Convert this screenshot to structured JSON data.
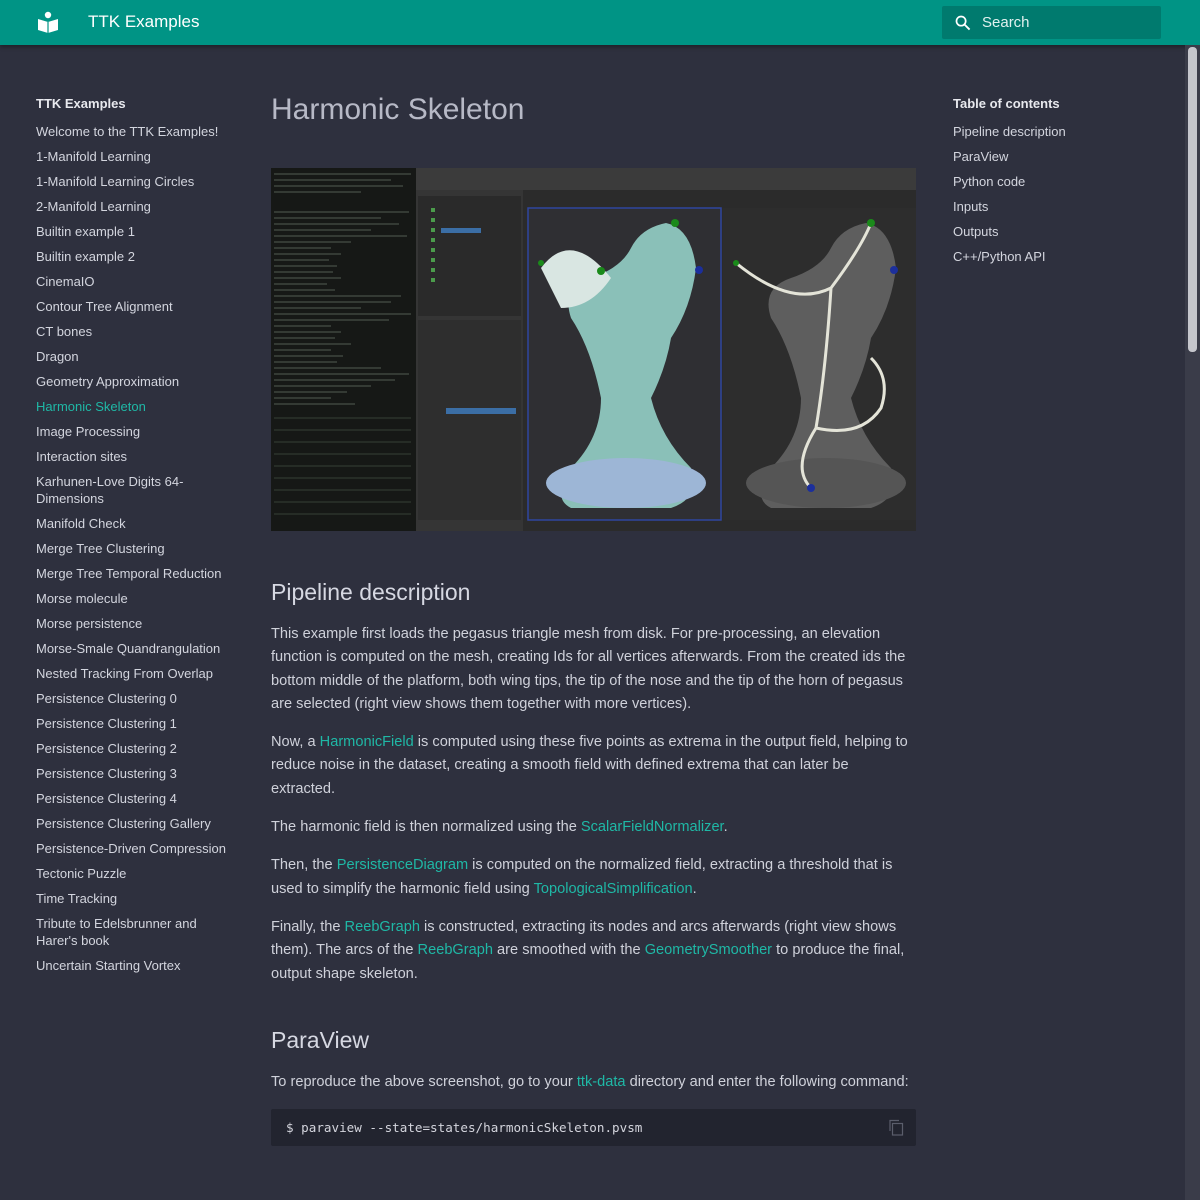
{
  "header": {
    "site_title": "TTK Examples",
    "search_placeholder": "Search"
  },
  "nav": {
    "title": "TTK Examples",
    "items": [
      "Welcome to the TTK Examples!",
      "1-Manifold Learning",
      "1-Manifold Learning Circles",
      "2-Manifold Learning",
      "Builtin example 1",
      "Builtin example 2",
      "CinemaIO",
      "Contour Tree Alignment",
      "CT bones",
      "Dragon",
      "Geometry Approximation",
      "Harmonic Skeleton",
      "Image Processing",
      "Interaction sites",
      "Karhunen-Love Digits 64-Dimensions",
      "Manifold Check",
      "Merge Tree Clustering",
      "Merge Tree Temporal Reduction",
      "Morse molecule",
      "Morse persistence",
      "Morse-Smale Quandrangulation",
      "Nested Tracking From Overlap",
      "Persistence Clustering 0",
      "Persistence Clustering 1",
      "Persistence Clustering 2",
      "Persistence Clustering 3",
      "Persistence Clustering 4",
      "Persistence Clustering Gallery",
      "Persistence-Driven Compression",
      "Tectonic Puzzle",
      "Time Tracking",
      "Tribute to Edelsbrunner and Harer's book",
      "Uncertain Starting Vortex"
    ],
    "active_item": "Harmonic Skeleton"
  },
  "toc": {
    "title": "Table of contents",
    "items": [
      "Pipeline description",
      "ParaView",
      "Python code",
      "Inputs",
      "Outputs",
      "C++/Python API"
    ]
  },
  "content": {
    "page_title": "Harmonic Skeleton",
    "pipeline_heading": "Pipeline description",
    "p1": "This example first loads the pegasus triangle mesh from disk. For pre-processing, an elevation function is computed on the mesh, creating Ids for all vertices afterwards. From the created ids the bottom middle of the platform, both wing tips, the tip of the nose and the tip of the horn of pegasus are selected (right view shows them together with more vertices).",
    "p2": {
      "a": "Now, a ",
      "link1": "HarmonicField",
      "b": " is computed using these five points as extrema in the output field, helping to reduce noise in the dataset, creating a smooth field with defined extrema that can later be extracted."
    },
    "p3": {
      "a": "The harmonic field is then normalized using the ",
      "link1": "ScalarFieldNormalizer",
      "b": "."
    },
    "p4": {
      "a": "Then, the ",
      "link1": "PersistenceDiagram",
      "b": " is computed on the normalized field, extracting a threshold that is used to simplify the harmonic field using ",
      "link2": "TopologicalSimplification",
      "c": "."
    },
    "p5": {
      "a": "Finally, the ",
      "link1": "ReebGraph",
      "b": " is constructed, extracting its nodes and arcs afterwards (right view shows them). The arcs of the ",
      "link2": "ReebGraph",
      "c": " are smoothed with the ",
      "link3": "GeometrySmoother",
      "d": " to produce the final, output shape skeleton."
    },
    "paraview_heading": "ParaView",
    "p6": {
      "a": "To reproduce the above screenshot, go to your ",
      "link1": "ttk-data",
      "b": " directory and enter the following command:"
    },
    "code": "$ paraview --state=states/harmonicSkeleton.pvsm"
  },
  "colors": {
    "header": "#009485",
    "background": "#2e303e",
    "accent": "#1fb8a6"
  }
}
